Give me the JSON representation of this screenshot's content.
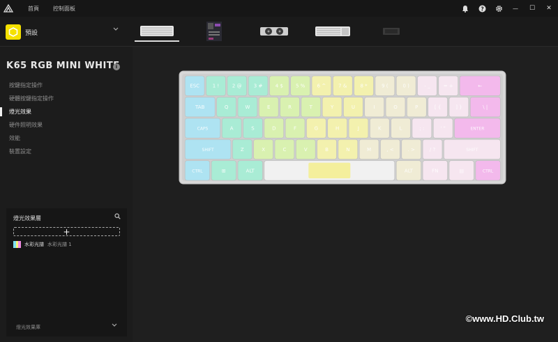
{
  "titlebar": {
    "nav": [
      "首頁",
      "控制面板"
    ],
    "icons": [
      "bell-icon",
      "help-icon",
      "settings-icon",
      "minimize-icon",
      "maximize-icon",
      "close-icon"
    ],
    "glyphs": {
      "minimize": "—",
      "maximize": "☐",
      "close": "✕"
    }
  },
  "profile": {
    "name": "預設",
    "accent": "#f5e100"
  },
  "devices": [
    "keyboard-k65",
    "motherboard",
    "graphics-card",
    "keyboard-full",
    "gpu-small"
  ],
  "sidebar": {
    "device_title": "K65 RGB MINI WHITE",
    "info": "i",
    "menu": [
      "按鍵指定操作",
      "硬體按鍵指定操作",
      "燈光效果",
      "硬件照明效果",
      "效能",
      "裝置設定"
    ],
    "active_index": 2
  },
  "panel": {
    "header": "燈光效果層",
    "add": "+",
    "layer_name": "水彩光譜",
    "layer_sub": "水彩光譜 1",
    "footer": "燈光效果庫"
  },
  "keyboard": {
    "rows": [
      [
        "ESC",
        "1 !",
        "2 @",
        "3 #",
        "4 $",
        "5 %",
        "6 ^",
        "7 &",
        "8 *",
        "9 (",
        "0 )",
        "- _",
        "= +",
        "←"
      ],
      [
        "TAB",
        "Q",
        "W",
        "E",
        "R",
        "T",
        "Y",
        "U",
        "I",
        "O",
        "P",
        "[ {",
        "] }",
        "\\ |"
      ],
      [
        "CAPS",
        "A",
        "S",
        "D",
        "F",
        "G",
        "H",
        "J",
        "K",
        "L",
        "; :",
        "' \"",
        "ENTER"
      ],
      [
        "SHIFT",
        "Z",
        "X",
        "C",
        "V",
        "B",
        "N",
        "M",
        ", <",
        ". >",
        "/ ?",
        "SHIFT"
      ],
      [
        "CTRL",
        "⊞",
        "ALT",
        "",
        "ALT",
        "FN",
        "▤",
        "CTRL"
      ]
    ],
    "colors": [
      "#aee3f2",
      "#a9ecd5",
      "#d9f1b0",
      "#f3f1ae",
      "#f0ecd5",
      "#f6e6f0",
      "#f3b9ec"
    ]
  },
  "watermark": "©www.HD.Club.tw"
}
